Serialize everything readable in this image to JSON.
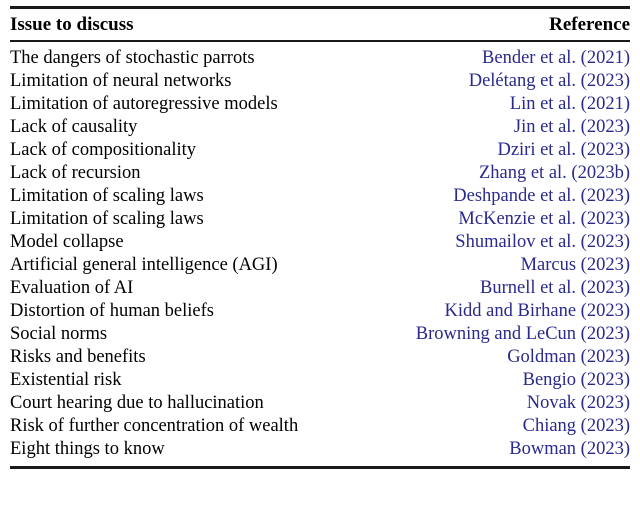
{
  "table": {
    "columns": [
      {
        "key": "issue",
        "label": "Issue to discuss",
        "align": "left"
      },
      {
        "key": "reference",
        "label": "Reference",
        "align": "right"
      }
    ],
    "link_color": "#2a2a8c",
    "rows": [
      {
        "issue": "The dangers of stochastic parrots",
        "reference": "Bender et al. (2021)"
      },
      {
        "issue": "Limitation of neural networks",
        "reference": "Delétang et al. (2023)"
      },
      {
        "issue": "Limitation of autoregressive models",
        "reference": "Lin et al. (2021)"
      },
      {
        "issue": "Lack of causality",
        "reference": "Jin et al. (2023)"
      },
      {
        "issue": "Lack of compositionality",
        "reference": "Dziri et al. (2023)"
      },
      {
        "issue": "Lack of recursion",
        "reference": "Zhang et al. (2023b)"
      },
      {
        "issue": "Limitation of scaling laws",
        "reference": "Deshpande et al. (2023)"
      },
      {
        "issue": "Limitation of scaling laws",
        "reference": "McKenzie et al. (2023)"
      },
      {
        "issue": "Model collapse",
        "reference": "Shumailov et al. (2023)"
      },
      {
        "issue": "Artificial general intelligence (AGI)",
        "reference": "Marcus (2023)"
      },
      {
        "issue": "Evaluation of AI",
        "reference": "Burnell et al. (2023)"
      },
      {
        "issue": "Distortion of human beliefs",
        "reference": "Kidd and Birhane (2023)"
      },
      {
        "issue": "Social norms",
        "reference": "Browning and LeCun (2023)"
      },
      {
        "issue": "Risks and benefits",
        "reference": "Goldman (2023)"
      },
      {
        "issue": "Existential risk",
        "reference": "Bengio (2023)"
      },
      {
        "issue": "Court hearing due to hallucination",
        "reference": "Novak (2023)"
      },
      {
        "issue": "Risk of further concentration of wealth",
        "reference": "Chiang (2023)"
      },
      {
        "issue": "Eight things to know",
        "reference": "Bowman (2023)"
      }
    ]
  }
}
